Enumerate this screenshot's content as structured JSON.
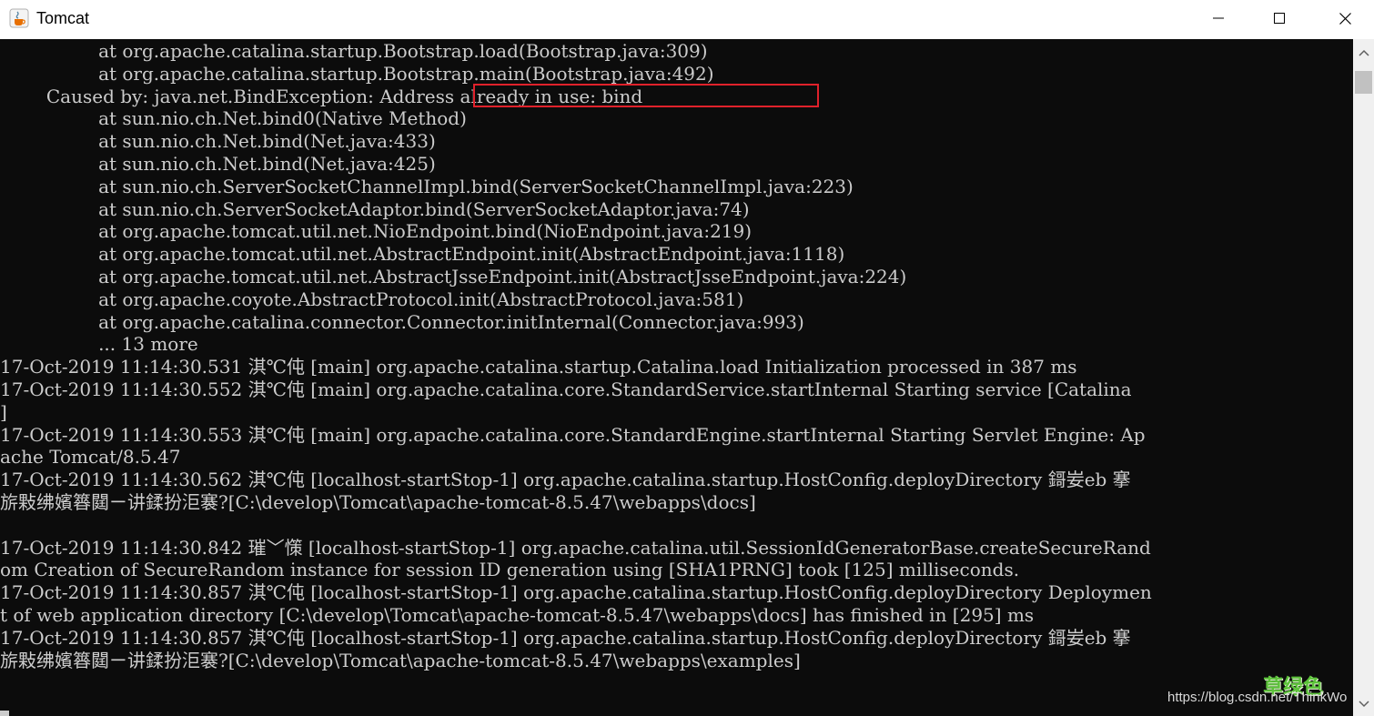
{
  "window": {
    "title": "Tomcat",
    "icons": {
      "app": "java-cup-icon",
      "minimize": "minimize-icon",
      "maximize": "maximize-icon",
      "close": "close-icon"
    }
  },
  "console": {
    "lines": [
      "                 at org.apache.catalina.startup.Bootstrap.load(Bootstrap.java:309)",
      "                 at org.apache.catalina.startup.Bootstrap.main(Bootstrap.java:492)",
      "        Caused by: java.net.BindException: Address already in use: bind",
      "                 at sun.nio.ch.Net.bind0(Native Method)",
      "                 at sun.nio.ch.Net.bind(Net.java:433)",
      "                 at sun.nio.ch.Net.bind(Net.java:425)",
      "                 at sun.nio.ch.ServerSocketChannelImpl.bind(ServerSocketChannelImpl.java:223)",
      "                 at sun.nio.ch.ServerSocketAdaptor.bind(ServerSocketAdaptor.java:74)",
      "                 at org.apache.tomcat.util.net.NioEndpoint.bind(NioEndpoint.java:219)",
      "                 at org.apache.tomcat.util.net.AbstractEndpoint.init(AbstractEndpoint.java:1118)",
      "                 at org.apache.tomcat.util.net.AbstractJsseEndpoint.init(AbstractJsseEndpoint.java:224)",
      "                 at org.apache.coyote.AbstractProtocol.init(AbstractProtocol.java:581)",
      "                 at org.apache.catalina.connector.Connector.initInternal(Connector.java:993)",
      "                 ... 13 more",
      "17-Oct-2019 11:14:30.531 淇℃伅 [main] org.apache.catalina.startup.Catalina.load Initialization processed in 387 ms",
      "17-Oct-2019 11:14:30.552 淇℃伅 [main] org.apache.catalina.core.StandardService.startInternal Starting service [Catalina",
      "]",
      "17-Oct-2019 11:14:30.553 淇℃伅 [main] org.apache.catalina.core.StandardEngine.startInternal Starting Servlet Engine: Ap",
      "ache Tomcat/8.5.47",
      "17-Oct-2019 11:14:30.562 淇℃伅 [localhost-startStop-1] org.apache.catalina.startup.HostConfig.deployDirectory 鎶妛eb 搴",
      "旂敤绋嬪簭閮ㄧ讲鍒扮洰褰?[C:\\develop\\Tomcat\\apache-tomcat-8.5.47\\webapps\\docs]",
      "",
      "17-Oct-2019 11:14:30.842 璀﹀憡 [localhost-startStop-1] org.apache.catalina.util.SessionIdGeneratorBase.createSecureRand",
      "om Creation of SecureRandom instance for session ID generation using [SHA1PRNG] took [125] milliseconds.",
      "17-Oct-2019 11:14:30.857 淇℃伅 [localhost-startStop-1] org.apache.catalina.startup.HostConfig.deployDirectory Deploymen",
      "t of web application directory [C:\\develop\\Tomcat\\apache-tomcat-8.5.47\\webapps\\docs] has finished in [295] ms",
      "17-Oct-2019 11:14:30.857 淇℃伅 [localhost-startStop-1] org.apache.catalina.startup.HostConfig.deployDirectory 鎶妛eb 搴",
      "旂敤绋嬪簭閮ㄧ讲鍒扮洰褰?[C:\\develop\\Tomcat\\apache-tomcat-8.5.47\\webapps\\examples]"
    ],
    "highlight_color": "#e0212b"
  },
  "watermark": {
    "brand": "草绿色",
    "url": "https://blog.csdn.net/ThinkWo"
  }
}
